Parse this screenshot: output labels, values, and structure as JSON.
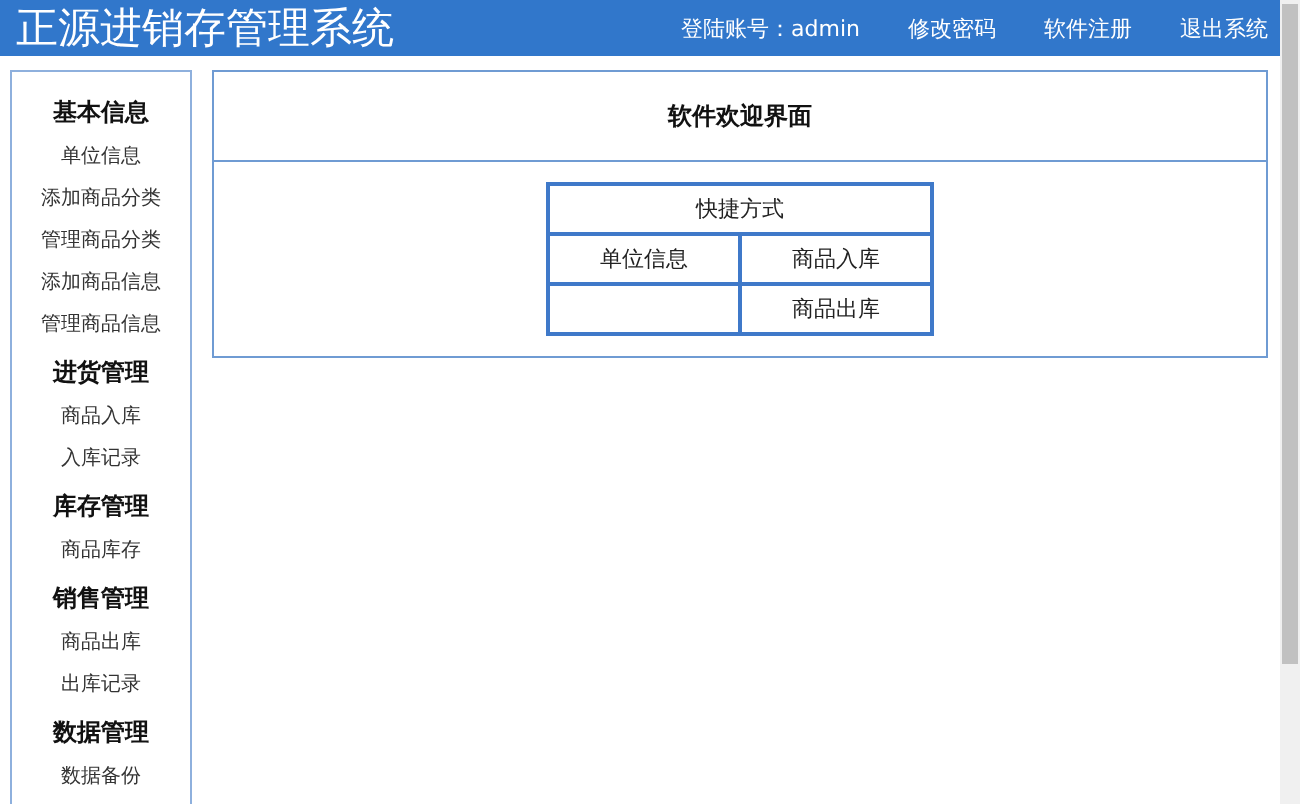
{
  "header": {
    "title": "正源进销存管理系统",
    "links": [
      {
        "label": "登陆账号：admin"
      },
      {
        "label": "修改密码"
      },
      {
        "label": "软件注册"
      },
      {
        "label": "退出系统"
      }
    ]
  },
  "sidebar": {
    "sections": [
      {
        "heading": "基本信息",
        "items": [
          "单位信息",
          "添加商品分类",
          "管理商品分类",
          "添加商品信息",
          "管理商品信息"
        ]
      },
      {
        "heading": "进货管理",
        "items": [
          "商品入库",
          "入库记录"
        ]
      },
      {
        "heading": "库存管理",
        "items": [
          "商品库存"
        ]
      },
      {
        "heading": "销售管理",
        "items": [
          "商品出库",
          "出库记录"
        ]
      },
      {
        "heading": "数据管理",
        "items": [
          "数据备份"
        ]
      }
    ]
  },
  "main": {
    "title": "软件欢迎界面",
    "shortcuts": {
      "caption": "快捷方式",
      "rows": [
        [
          "单位信息",
          "商品入库"
        ],
        [
          "",
          "商品出库"
        ]
      ]
    }
  }
}
